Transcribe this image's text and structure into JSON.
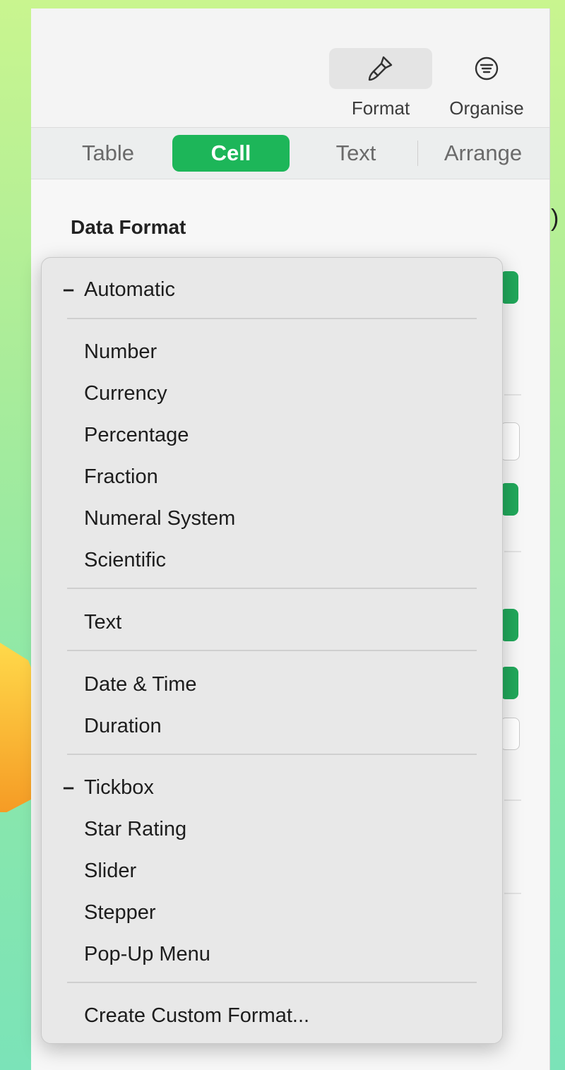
{
  "toolbar": {
    "format_label": "Format",
    "organise_label": "Organise"
  },
  "tabs": [
    {
      "label": "Table"
    },
    {
      "label": "Cell",
      "active": true
    },
    {
      "label": "Text"
    },
    {
      "label": "Arrange"
    }
  ],
  "inspector": {
    "section_title": "Data Format"
  },
  "menu": {
    "items": [
      {
        "label": "Automatic",
        "marked": true
      },
      {
        "label": "Number"
      },
      {
        "label": "Currency"
      },
      {
        "label": "Percentage"
      },
      {
        "label": "Fraction"
      },
      {
        "label": "Numeral System"
      },
      {
        "label": "Scientific"
      },
      {
        "label": "Text"
      },
      {
        "label": "Date & Time"
      },
      {
        "label": "Duration"
      },
      {
        "label": "Tickbox",
        "marked": true
      },
      {
        "label": "Star Rating"
      },
      {
        "label": "Slider"
      },
      {
        "label": "Stepper"
      },
      {
        "label": "Pop-Up Menu"
      },
      {
        "label": "Create Custom Format..."
      }
    ]
  },
  "colors": {
    "accent": "#1db659",
    "background_top": "#c9f58f",
    "background_bottom": "#7be3b8",
    "arrow": "#f7a72a"
  }
}
